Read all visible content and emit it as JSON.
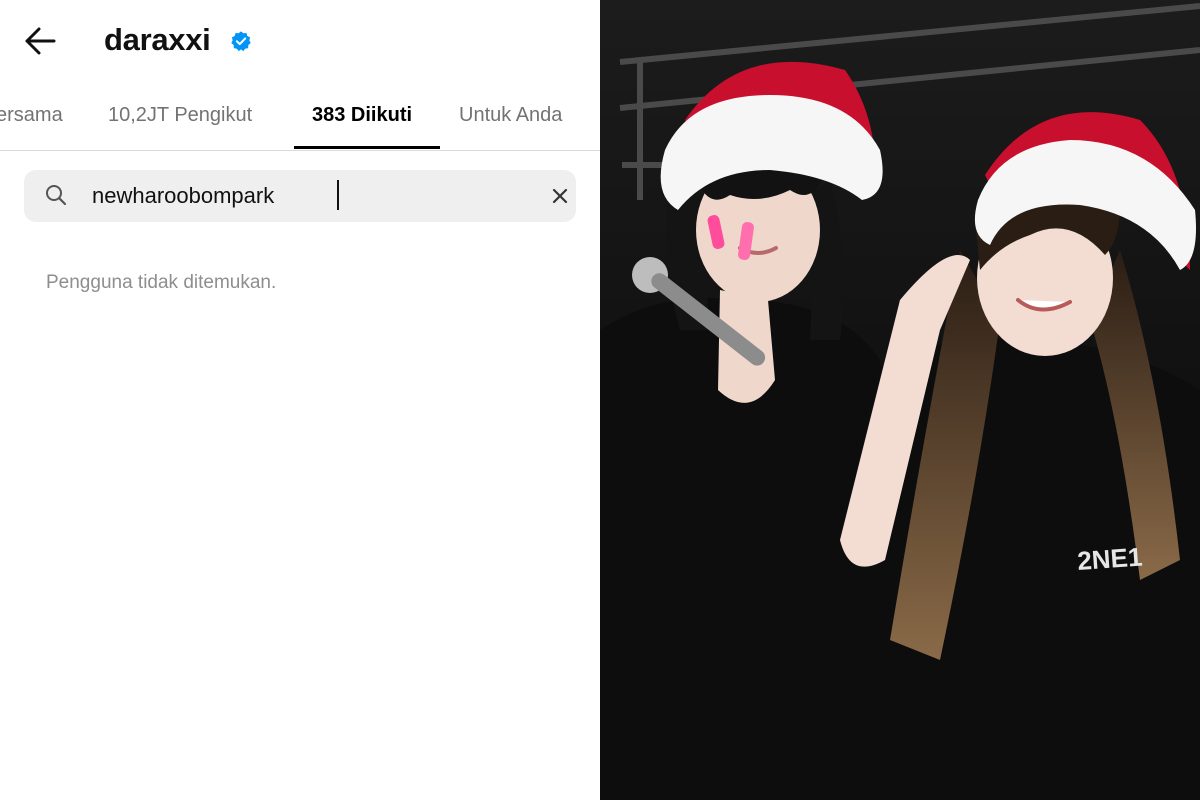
{
  "header": {
    "username": "daraxxi",
    "back_icon": "back-arrow-icon",
    "verified_icon": "verified-badge-icon",
    "verified_color": "#0095f6"
  },
  "tabs": [
    {
      "label": "ersama",
      "active": false
    },
    {
      "label": "10,2JT Pengikut",
      "active": false
    },
    {
      "label": "383 Diikuti",
      "active": true
    },
    {
      "label": "Untuk Anda",
      "active": false
    }
  ],
  "search": {
    "value": "newharoobompark",
    "placeholder": "",
    "search_icon": "search-icon",
    "clear_icon": "clear-icon"
  },
  "results": {
    "empty_message": "Pengguna tidak ditemukan."
  },
  "photo": {
    "hat_red": "#c8102e",
    "hat_white": "#f6f6f6",
    "shirt_black": "#0d0d0d",
    "print_text": "2NE1"
  }
}
